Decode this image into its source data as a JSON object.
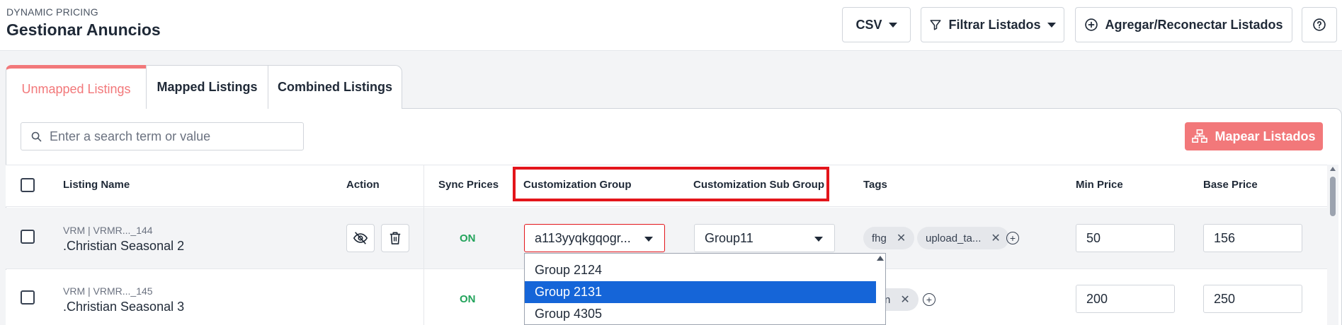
{
  "header": {
    "eyebrow": "DYNAMIC PRICING",
    "title": "Gestionar Anuncios",
    "csv_label": "CSV",
    "filter_label": "Filtrar Listados",
    "add_label": "Agregar/Reconectar Listados",
    "help_icon": "question-circle-icon"
  },
  "tabs": [
    {
      "label": "Unmapped Listings",
      "active": true
    },
    {
      "label": "Mapped Listings",
      "active": false
    },
    {
      "label": "Combined Listings",
      "active": false
    }
  ],
  "search": {
    "placeholder": "Enter a search term or value"
  },
  "map_button": {
    "label": "Mapear Listados"
  },
  "columns": {
    "listing_name": "Listing Name",
    "action": "Action",
    "sync_prices": "Sync Prices",
    "customization_group": "Customization Group",
    "customization_sub_group": "Customization Sub Group",
    "tags": "Tags",
    "min_price": "Min Price",
    "base_price": "Base Price"
  },
  "rows": [
    {
      "sub": "VRM | VRMR..._144",
      "name": ".Christian Seasonal 2",
      "sync": "ON",
      "group": "a113yyqkgqogr...",
      "sub_group": "Group11",
      "tags": [
        "fhg",
        "upload_ta..."
      ],
      "min_price": "50",
      "base_price": "156"
    },
    {
      "sub": "VRM | VRMR..._145",
      "name": ".Christian Seasonal 3",
      "sync": "ON",
      "tag_partial": "n",
      "min_price": "200",
      "base_price": "250"
    }
  ],
  "dropdown": {
    "options": [
      "Group 2124",
      "Group 2131",
      "Group 4305"
    ],
    "selected": "Group 2131"
  },
  "colors": {
    "accent": "#f2787a",
    "highlight_border": "#e3151b",
    "sync_on": "#22a35b",
    "option_selected": "#1565d8"
  }
}
